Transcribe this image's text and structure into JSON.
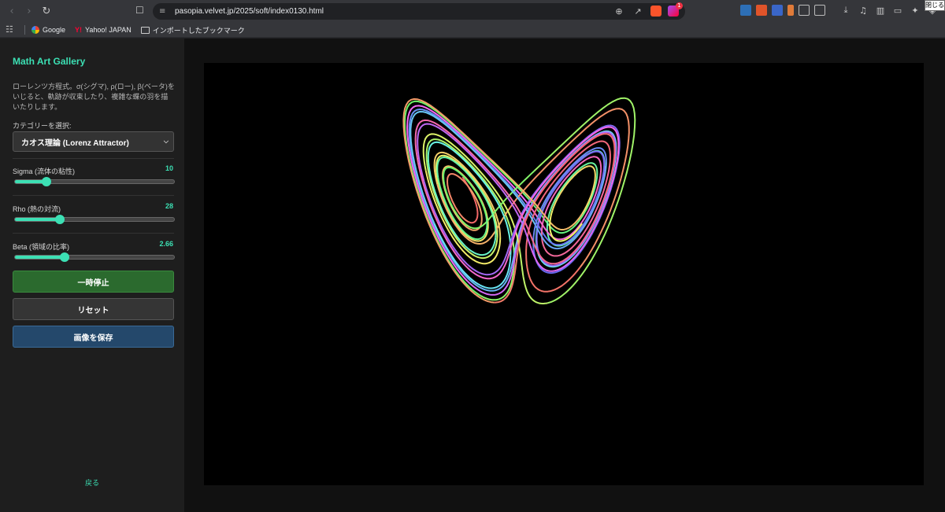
{
  "browser": {
    "url": "pasopia.velvet.jp/2025/soft/index0130.html",
    "close_label": "閉じる",
    "rewards_badge": "1"
  },
  "bookmarks": [
    {
      "label": "Google"
    },
    {
      "label": "Yahoo! JAPAN"
    },
    {
      "label": "インポートしたブックマーク"
    }
  ],
  "sidebar": {
    "title": "Math Art Gallery",
    "description": "ローレンツ方程式。σ(シグマ), ρ(ロー), β(ベータ)をいじると、軌跡が収束したり、複雑な蝶の羽を描いたりします。",
    "category_label": "カテゴリーを選択:",
    "category_value": "カオス理論 (Lorenz Attractor)",
    "params": [
      {
        "label": "Sigma (流体の粘性)",
        "value": "10",
        "fraction": 0.2
      },
      {
        "label": "Rho (熱の対流)",
        "value": "28",
        "fraction": 0.28
      },
      {
        "label": "Beta (領域の比率)",
        "value": "2.66",
        "fraction": 0.31
      }
    ],
    "pause_label": "一時停止",
    "reset_label": "リセット",
    "save_label": "画像を保存",
    "back_label": "戻る"
  },
  "colors": {
    "accent": "#3ce0b4",
    "pause_bg": "#2b6a2e",
    "save_bg": "#24486b"
  }
}
